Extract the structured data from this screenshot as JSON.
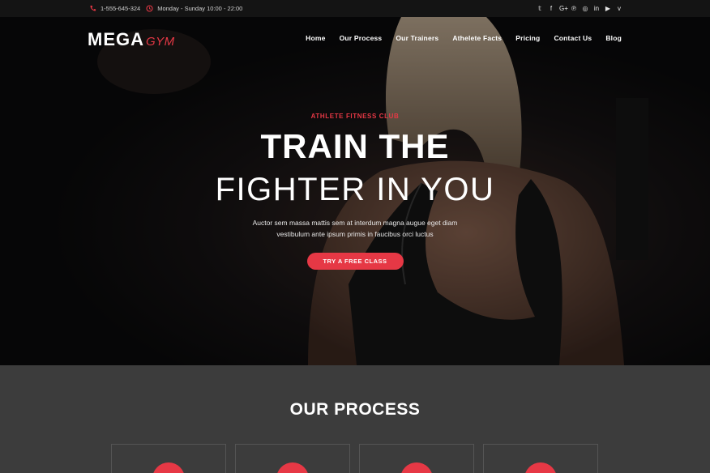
{
  "topbar": {
    "phone": "1-555-645-324",
    "hours": "Monday - Sunday 10:00 - 22:00",
    "social_icons": [
      "twitter-icon",
      "facebook-icon",
      "google-plus-icon",
      "pinterest-icon",
      "instagram-icon",
      "linkedin-icon",
      "youtube-icon",
      "vimeo-icon"
    ],
    "social_glyphs": [
      "𝕥",
      "f",
      "G+",
      "℗",
      "◎",
      "in",
      "▶",
      "v"
    ]
  },
  "brand": {
    "mega": "MEGA",
    "gym": "GYM"
  },
  "nav": {
    "items": [
      "Home",
      "Our Process",
      "Our Trainers",
      "Athelete Facts",
      "Pricing",
      "Contact Us",
      "Blog"
    ]
  },
  "hero": {
    "eyebrow": "ATHLETE FITNESS CLUB",
    "title_line1": "TRAIN THE",
    "title_line2": "FIGHTER IN YOU",
    "description": "Auctor sem massa mattis sem at interdum magna augue eget diam vestibulum ante ipsum primis in faucibus orci luctus",
    "cta_label": "TRY A FREE CLASS"
  },
  "process": {
    "title": "OUR PROCESS",
    "card_count": 4
  },
  "colors": {
    "accent": "#e63845",
    "topbar_bg": "#141414",
    "section_bg": "#3c3c3c"
  }
}
